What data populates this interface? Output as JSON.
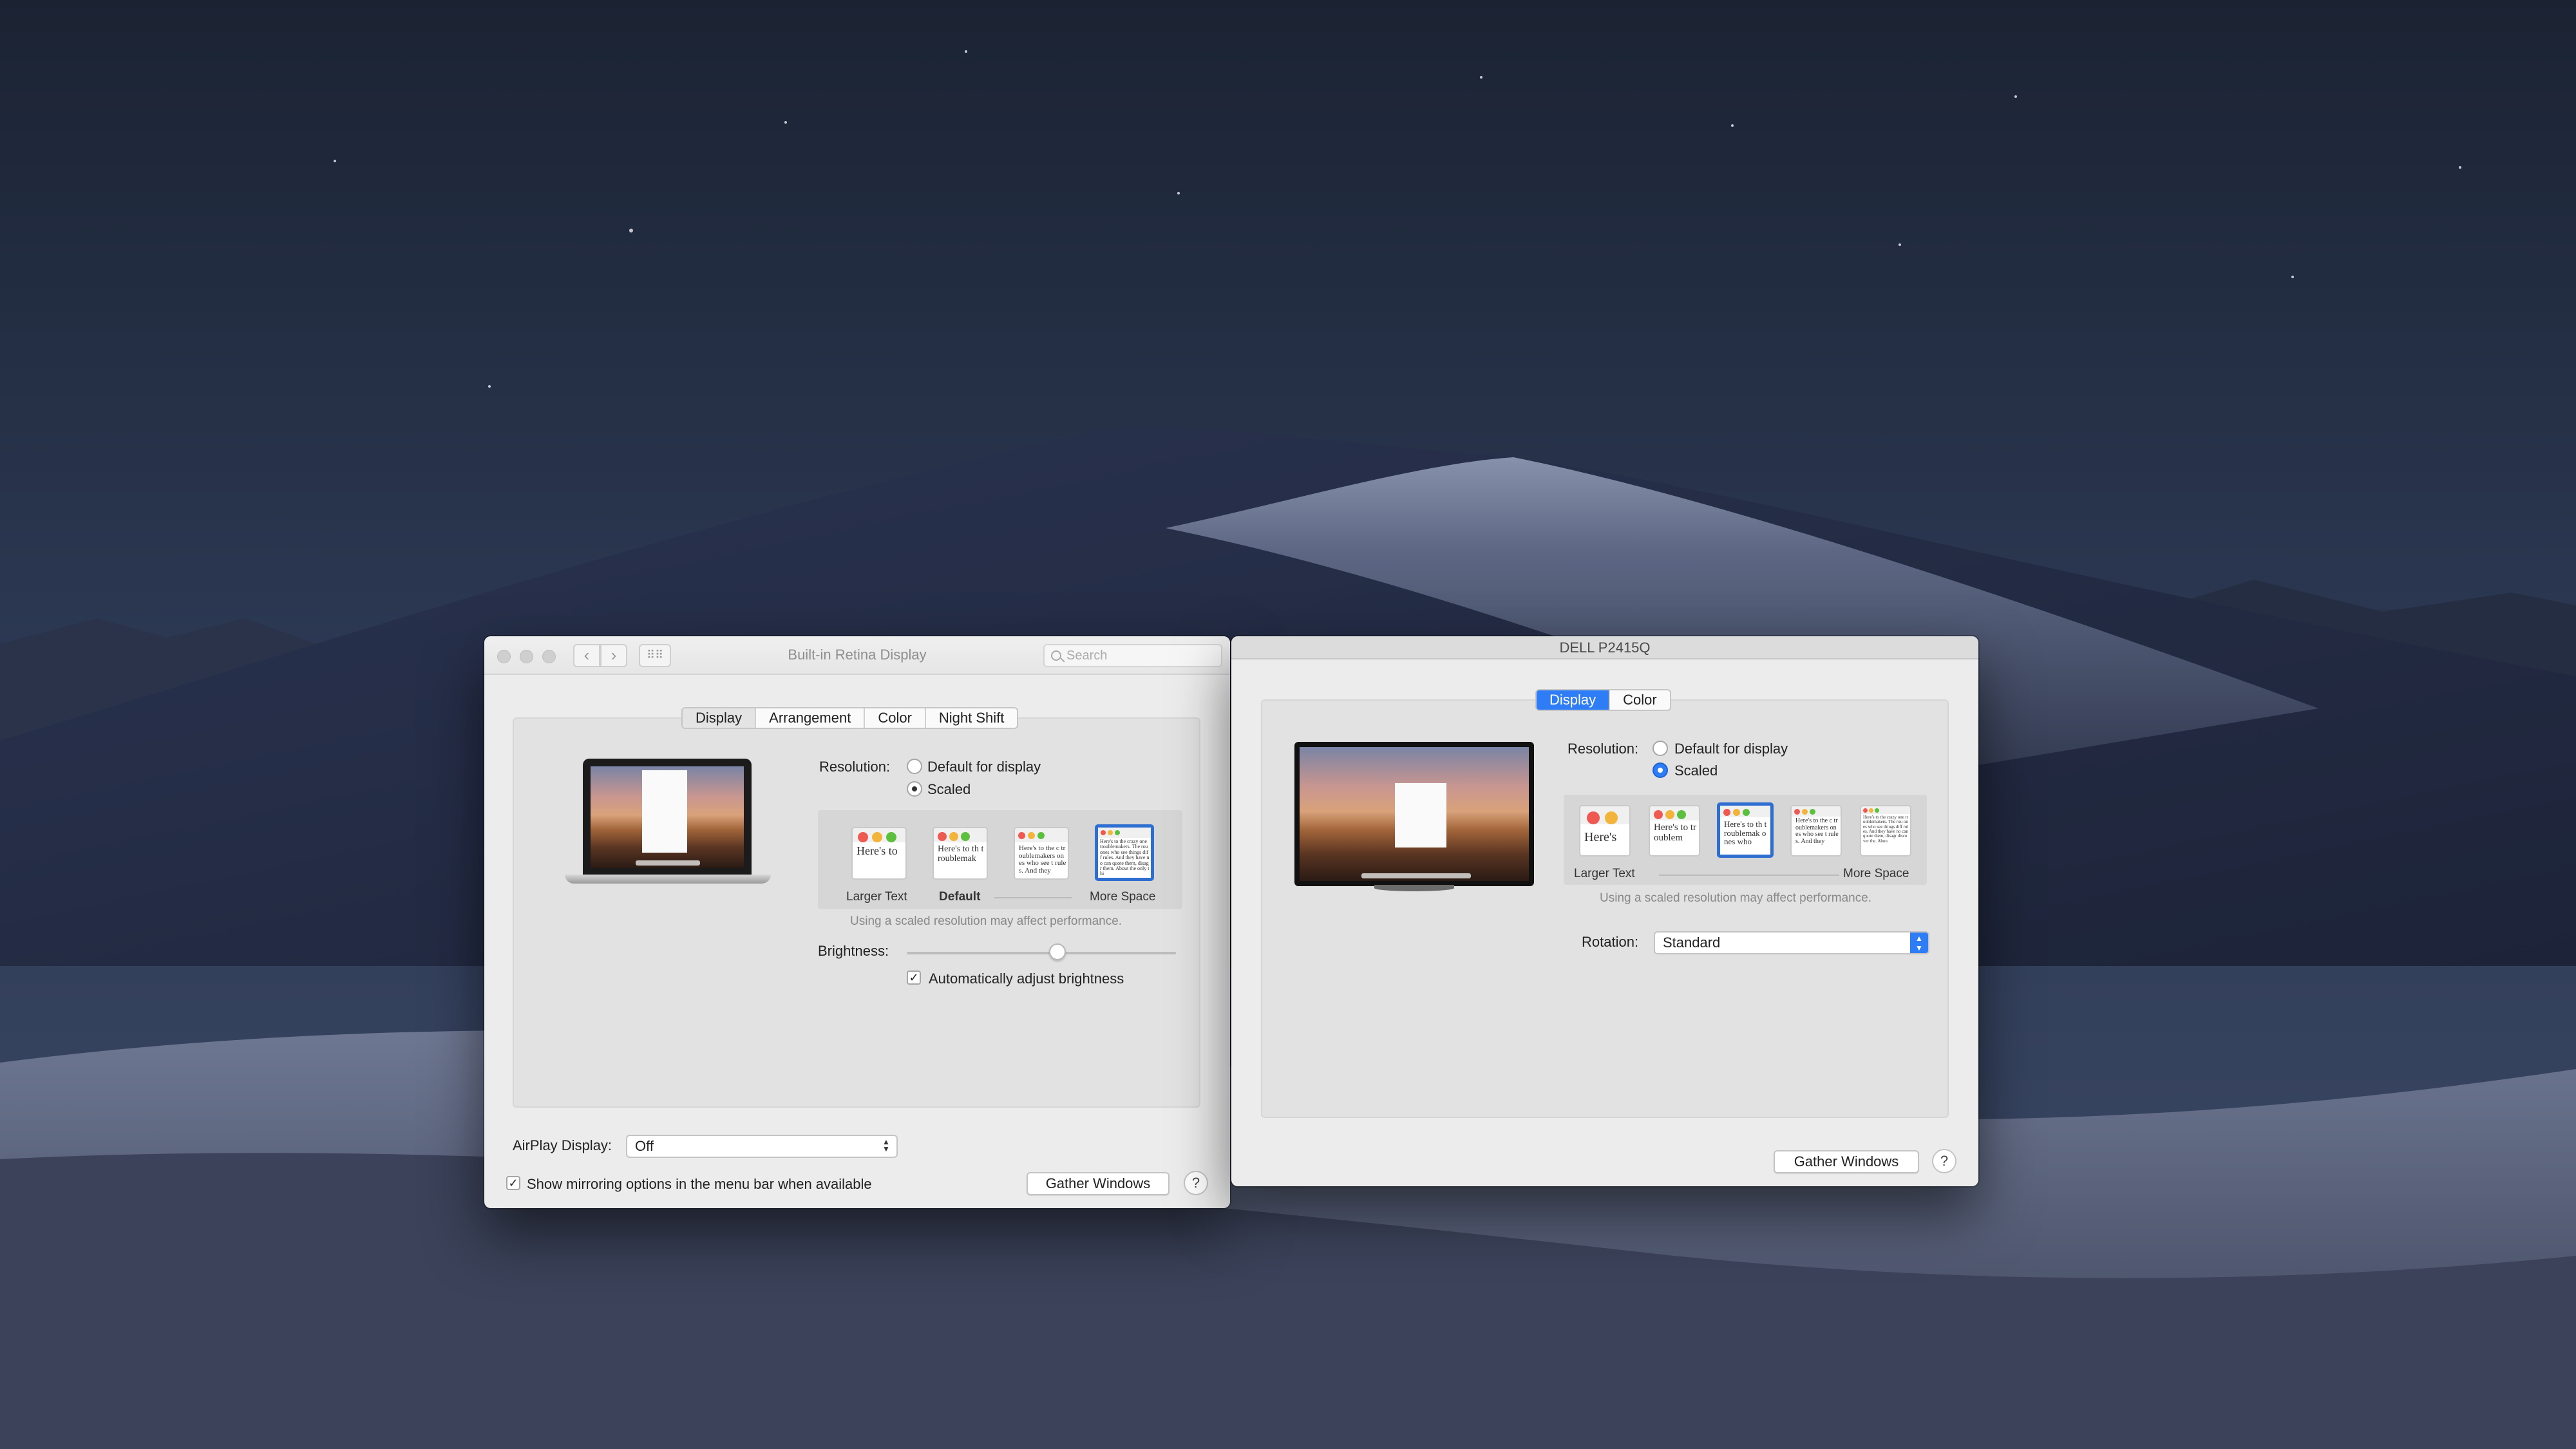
{
  "window1": {
    "title": "Built-in Retina Display",
    "search_placeholder": "Search",
    "tabs": [
      {
        "label": "Display",
        "selected": true
      },
      {
        "label": "Arrangement",
        "selected": false
      },
      {
        "label": "Color",
        "selected": false
      },
      {
        "label": "Night Shift",
        "selected": false
      }
    ],
    "resolution_label": "Resolution:",
    "resolution_options": [
      {
        "label": "Default for display",
        "selected": false
      },
      {
        "label": "Scaled",
        "selected": true
      }
    ],
    "scale_thumbs": [
      "Here's to",
      "Here's to th troublemak",
      "Here's to the c troublemakers ones who see t rules. And they",
      "Here's to the crazy one troublemakers. The rou ones who see things diff rules. And they have no can quote them, disagr them. About the only thi"
    ],
    "scale_labels": {
      "left": "Larger Text",
      "middle": "Default",
      "right": "More Space"
    },
    "scale_note": "Using a scaled resolution may affect performance.",
    "brightness_label": "Brightness:",
    "brightness_level": 0.56,
    "auto_brightness_label": "Automatically adjust brightness",
    "auto_brightness_checked": true,
    "airplay_label": "AirPlay Display:",
    "airplay_value": "Off",
    "mirroring_label": "Show mirroring options in the menu bar when available",
    "mirroring_checked": true,
    "gather_button": "Gather Windows",
    "help_button": "?"
  },
  "window2": {
    "title": "DELL P2415Q",
    "tabs": [
      {
        "label": "Display",
        "selected": true
      },
      {
        "label": "Color",
        "selected": false
      }
    ],
    "resolution_label": "Resolution:",
    "resolution_options": [
      {
        "label": "Default for display",
        "selected": false
      },
      {
        "label": "Scaled",
        "selected": true
      }
    ],
    "scale_thumbs": [
      "Here's",
      "Here's to troublem",
      "Here's to th troublemak ones who",
      "Here's to the c troublemakers ones who see t rules. And they",
      "Here's to the crazy one troublemakers. The rou ones who see things diff rules. And they have no can quote them, disagr discover the. Abou"
    ],
    "scale_labels": {
      "left": "Larger Text",
      "right": "More Space"
    },
    "scale_note": "Using a scaled resolution may affect performance.",
    "rotation_label": "Rotation:",
    "rotation_value": "Standard",
    "gather_button": "Gather Windows",
    "help_button": "?"
  },
  "colors": {
    "accent": "#2e7cf6",
    "selection_border": "#2e6ed0"
  },
  "icons": {
    "back": "chevron-left-icon",
    "forward": "chevron-right-icon",
    "grid": "grid-icon",
    "search": "search-icon"
  }
}
